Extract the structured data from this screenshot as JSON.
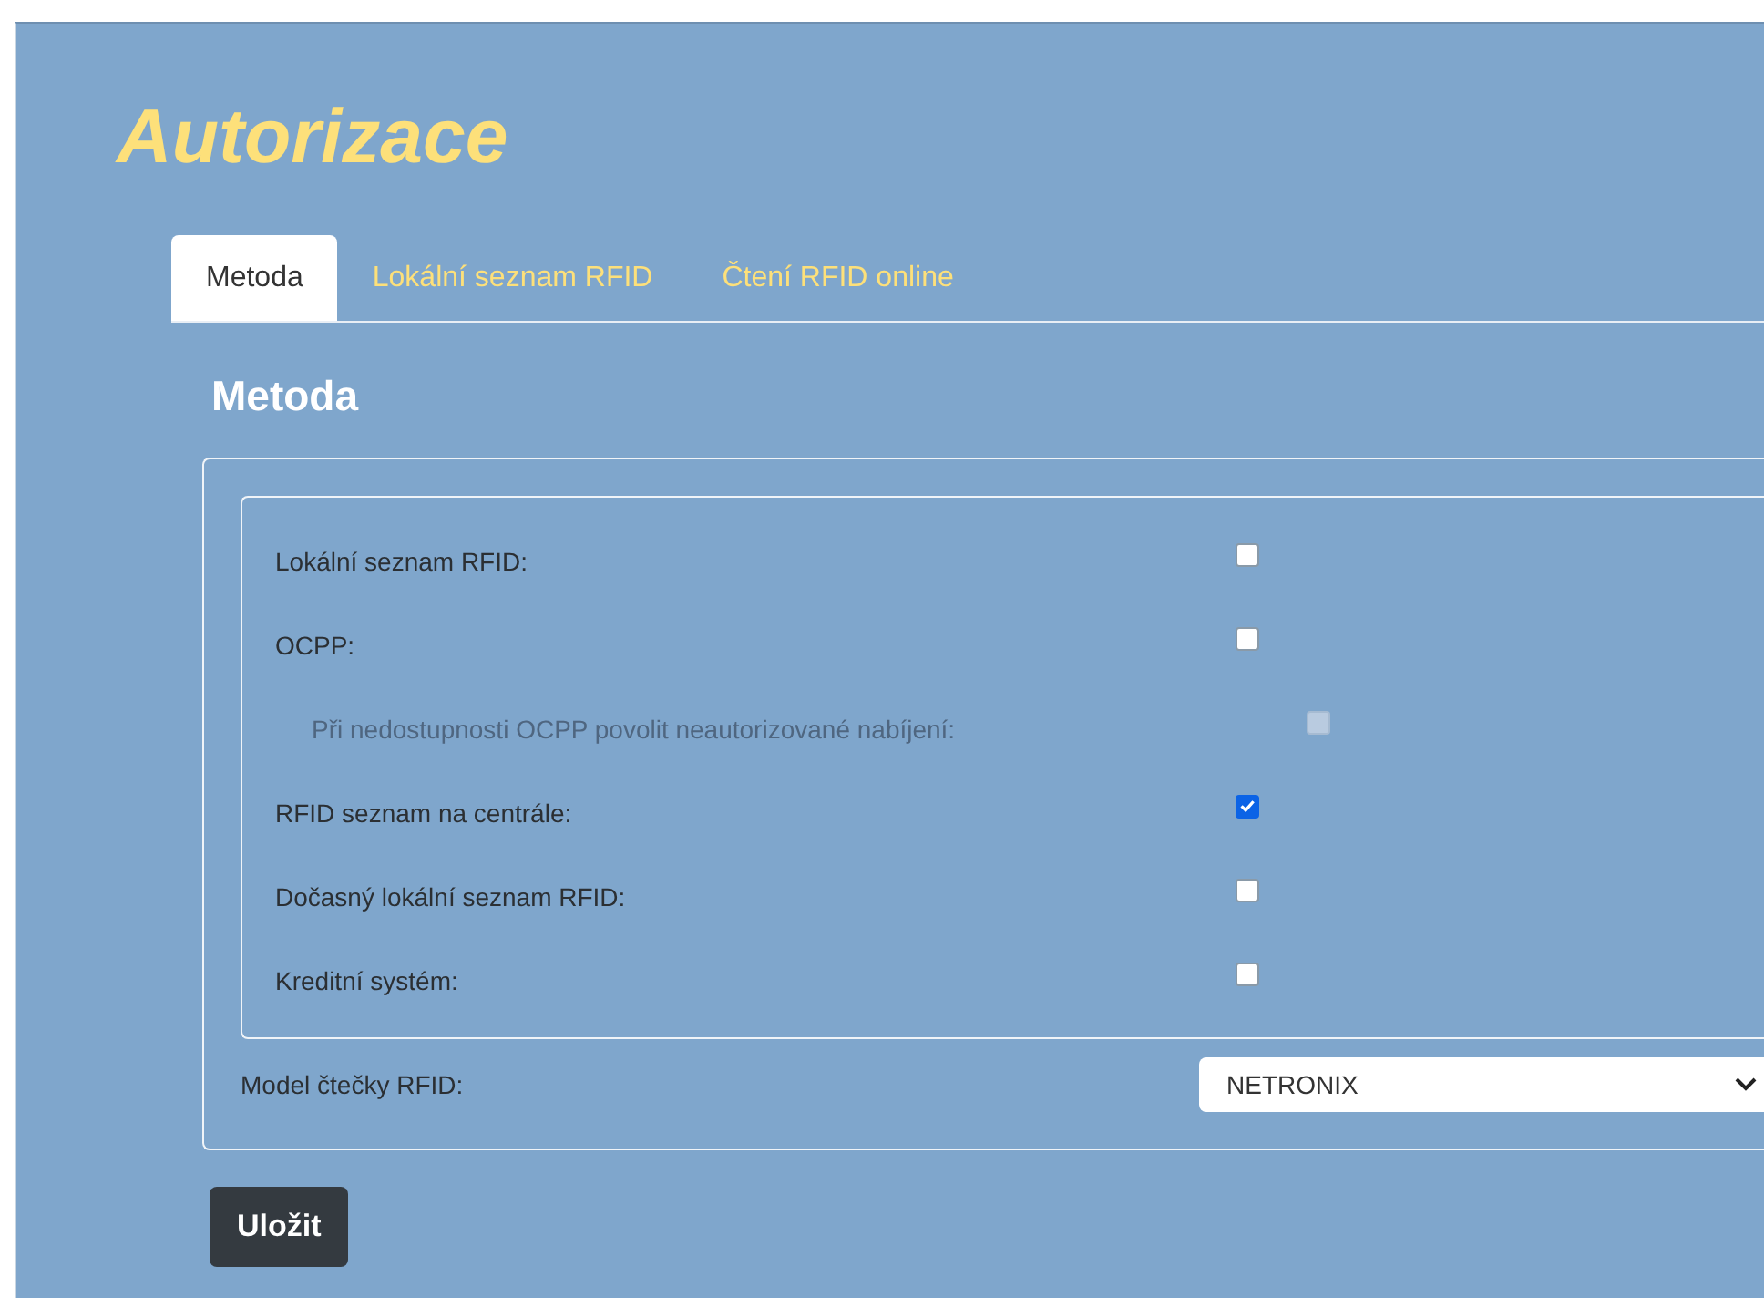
{
  "title": "Autorizace",
  "tabs": [
    {
      "label": "Metoda",
      "selected": true
    },
    {
      "label": "Lokální seznam RFID",
      "selected": false
    },
    {
      "label": "Čtení RFID online",
      "selected": false
    }
  ],
  "section_heading": "Metoda",
  "options": [
    {
      "label": "Lokální seznam RFID:",
      "checked": false,
      "disabled": false
    },
    {
      "label": "OCPP:",
      "checked": false,
      "disabled": false,
      "children": [
        {
          "label": "Při nedostupnosti OCPP povolit neautorizované nabíjení:",
          "checked": false,
          "disabled": true
        }
      ]
    },
    {
      "label": "RFID seznam na centrále:",
      "checked": true,
      "disabled": false
    },
    {
      "label": "Dočasný lokální seznam RFID:",
      "checked": false,
      "disabled": false
    },
    {
      "label": "Kreditní systém:",
      "checked": false,
      "disabled": false
    }
  ],
  "reader_model": {
    "label": "Model čtečky RFID:",
    "value": "NETRONIX"
  },
  "save_button": "Uložit"
}
